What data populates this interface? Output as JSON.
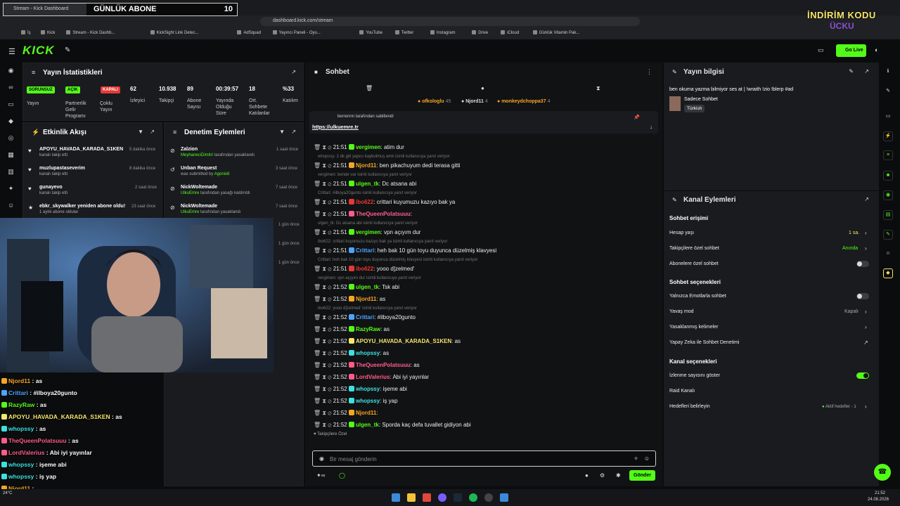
{
  "browser": {
    "tab_title": "Stream - Kick Dashboard",
    "url": "dashboard.kick.com/stream",
    "bookmarks": [
      "İş",
      "Kick",
      "Stream - Kick Dashb...",
      "KickSight Link Detec...",
      "AdSquad",
      "Yayıncı Paneli - Oyu...",
      "YouTube",
      "Twitter",
      "Instagram",
      "Drive",
      "iCloud",
      "Günlük Vitamin Pak..."
    ]
  },
  "overlay_banner": {
    "title": "GÜNLÜK ABONE",
    "count": "10"
  },
  "promo": {
    "line1": "İNDİRİM KODU",
    "line2": "ÜCKU"
  },
  "app": {
    "logo": "KICK",
    "go_live": "Go Live"
  },
  "stats": {
    "title": "Yayın İstatistikleri",
    "items": [
      {
        "badge": "SORUNSUZ",
        "label": "Yayın",
        "color": "#53fc18"
      },
      {
        "badge": "AÇIK",
        "label": "Partnerlik Gelir Programı",
        "color": "#53fc18"
      },
      {
        "badge": "KAPALI",
        "label": "Çoklu Yayın",
        "color": "#e53935"
      },
      {
        "value": "62",
        "label": "İzleyici"
      },
      {
        "value": "10.938",
        "label": "Takipçi"
      },
      {
        "value": "89",
        "label": "Abone Sayısı"
      },
      {
        "value": "00:39:57",
        "label": "Yayında Olduğu Süre"
      },
      {
        "value": "18",
        "label": "Ort. Sohbete Katılanlar"
      },
      {
        "value": "%33",
        "label": "Katılım"
      }
    ]
  },
  "activity": {
    "title": "Etkinlik Akışı",
    "items": [
      {
        "name": "APOYU_HAVADA_KARADA_S1KEN",
        "sub": "kanalı takip etti",
        "time": "5 dakika önce"
      },
      {
        "name": "muzlupastaseverim",
        "sub": "kanalı takip etti",
        "time": "8 dakika önce"
      },
      {
        "name": "gunayevo",
        "sub": "kanalı takip etti",
        "time": "2 saat önce"
      },
      {
        "name": "ebkr_skywalker yeniden abone oldu!",
        "sub": "1 aylık abone oldular",
        "time": "23 saat önce"
      }
    ]
  },
  "moderation": {
    "title": "Denetim Eylemleri",
    "items": [
      {
        "name": "Zalzion",
        "by": "MeyhaneciDimitri",
        "sub": "tarafından yasaklandı",
        "time": "1 saat önce"
      },
      {
        "name": "Unban Request",
        "by": "Agonix8",
        "sub": "was submitted by",
        "time": "3 saat önce"
      },
      {
        "name": "NickWoltemade",
        "by": "UlkuEmre",
        "sub": "tarafından yasağı kaldırıldı",
        "time": "7 saat önce"
      },
      {
        "name": "NickWoltemade",
        "by": "UlkuEmre",
        "sub": "tarafından yasaklandı",
        "time": "7 saat önce"
      }
    ],
    "extra_times": [
      "1 gün önce",
      "1 gün önce",
      "1 gün önce"
    ]
  },
  "chat": {
    "title": "Sohbet",
    "top_gifters": [
      {
        "name": "ofkologlu",
        "n": "45"
      },
      {
        "name": "Njord11",
        "n": "4"
      },
      {
        "name": "monkeydchoppa37",
        "n": "4"
      }
    ],
    "pinned_by": "berrennn tarafından sabitlendi",
    "pinned_link": "https://ulkuemre.tr",
    "messages": [
      {
        "reply": "",
        "time": "21:51",
        "user": "vergimen",
        "color": "#53fc18",
        "text": "atim dur"
      },
      {
        "reply": "whopssy: 2 dk giti yapıcı kaybolmuş amk isimli kullanıcıya yanıt veriyor",
        "time": "21:51",
        "user": "Njord11",
        "color": "#f5a623",
        "text": "ben pikachuyum dedi terasa gitti"
      },
      {
        "reply": "vergimen: bende var isimli kullanıcıya yanıt veriyor",
        "time": "21:51",
        "user": "ulgen_tk",
        "color": "#53fc18",
        "text": "Dc atsana abi"
      },
      {
        "reply": "Crittari: #ilboya20gunto isimli kullanıcıya yanıt veriyor",
        "time": "21:51",
        "user": "ibo622",
        "color": "#e53935",
        "text": "crittari kuyumuzu kazıyo bak ya"
      },
      {
        "reply": "",
        "time": "21:51",
        "user": "TheQueenPolatsuuu",
        "color": "#ff5c8a",
        "text": ""
      },
      {
        "reply": "ulgen_tk: Dc atsana abi isimli kullanıcıya yanıt veriyor",
        "time": "21:51",
        "user": "vergimen",
        "color": "#53fc18",
        "text": "vpn açıyım dur"
      },
      {
        "reply": "ibo622: crittari kuyumuzu kazıyo bak ya isimli kullanıcıya yanıt veriyor",
        "time": "21:51",
        "user": "Crittari",
        "color": "#4fa3ff",
        "text": "heh bak 10 gün toyu duyunca düzelmiş klavyesi"
      },
      {
        "reply": "Crittari: heh bak 10 gün toyu duyunca düzelmiş klavyesi isimli kullanıcıya yanıt veriyor",
        "time": "21:51",
        "user": "ibo622",
        "color": "#e53935",
        "text": "yooo d]zelmed'"
      },
      {
        "reply": "vergimen: vpn açıyım dur isimli kullanıcıya yanıt veriyor",
        "time": "21:52",
        "user": "ulgen_tk",
        "color": "#53fc18",
        "text": "Tsk abi"
      },
      {
        "reply": "",
        "time": "21:52",
        "user": "Njord11",
        "color": "#f5a623",
        "text": "as"
      },
      {
        "reply": "ibo622: yooo d]zelmed' isimli kullanıcıya yanıt veriyor",
        "time": "21:52",
        "user": "Crittari",
        "color": "#4fa3ff",
        "text": "#ilboya20gunto"
      },
      {
        "reply": "",
        "time": "21:52",
        "user": "RazyRaw",
        "color": "#53fc18",
        "text": "as"
      },
      {
        "reply": "",
        "time": "21:52",
        "user": "APOYU_HAVADA_KARADA_S1KEN",
        "color": "#f5e66b",
        "text": "as"
      },
      {
        "reply": "",
        "time": "21:52",
        "user": "whopssy",
        "color": "#3ee0e0",
        "text": "as"
      },
      {
        "reply": "",
        "time": "21:52",
        "user": "TheQueenPolatsuuu",
        "color": "#ff5c8a",
        "text": "as"
      },
      {
        "reply": "",
        "time": "21:52",
        "user": "LordValerius",
        "color": "#ff5c8a",
        "text": "Abi iyi yayınlar"
      },
      {
        "reply": "",
        "time": "21:52",
        "user": "whopssy",
        "color": "#3ee0e0",
        "text": "işeme abi"
      },
      {
        "reply": "",
        "time": "21:52",
        "user": "whopssy",
        "color": "#3ee0e0",
        "text": "iş yap"
      },
      {
        "reply": "",
        "time": "21:52",
        "user": "Njord11",
        "color": "#f5a623",
        "text": ""
      },
      {
        "reply": "",
        "time": "21:52",
        "user": "ulgen_tk",
        "color": "#53fc18",
        "text": "Sporda kaç defa tuvallet gidiyon abi"
      }
    ],
    "followers_only": "Takipçilere Özel",
    "input_placeholder": "Bir mesaj gönderin",
    "send": "Gönder"
  },
  "stream_info": {
    "title": "Yayın bilgisi",
    "stream_title": "ben okuma yazma bilmiyor ses at | !wraith !zio !blerp #ad",
    "category": "Sadece Sohbet",
    "tag": "Türkish"
  },
  "channel_actions": {
    "title": "Kanal Eylemleri",
    "sections": [
      {
        "header": "Sohbet erişimi",
        "rows": [
          {
            "label": "Hesap yaşı",
            "value": "1 sa."
          },
          {
            "label": "Takipçilere özel sohbet",
            "value": "Anında"
          },
          {
            "label": "Abonelere özel sohbet",
            "value": ""
          }
        ]
      },
      {
        "header": "Sohbet seçenekleri",
        "rows": [
          {
            "label": "Yalnızca Emotlarla sohbet",
            "value": ""
          },
          {
            "label": "Yavaş mod",
            "value": "Kapalı"
          },
          {
            "label": "Yasaklanmış kelimeler",
            "value": ""
          },
          {
            "label": "Yapay Zeka ile Sohbet Denetimi",
            "value": ""
          }
        ]
      },
      {
        "header": "Kanal seçenekleri",
        "rows": [
          {
            "label": "İzlenme sayısını göster",
            "value": ""
          },
          {
            "label": "Raid Kanalı",
            "value": ""
          },
          {
            "label": "Hedefleri belirleyin",
            "value": "Aktif hedefler - 1"
          }
        ]
      }
    ]
  },
  "overlay_chat": [
    {
      "user": "Njord11",
      "color": "#f5a623",
      "text": "as"
    },
    {
      "user": "Crittari",
      "color": "#4fa3ff",
      "text": "#ilboya20gunto"
    },
    {
      "user": "RazyRaw",
      "color": "#53fc18",
      "text": "as"
    },
    {
      "user": "APOYU_HAVADA_KARADA_S1KEN",
      "color": "#f5e66b",
      "text": "as"
    },
    {
      "user": "whopssy",
      "color": "#3ee0e0",
      "text": "as"
    },
    {
      "user": "TheQueenPolatsuuu",
      "color": "#ff5c8a",
      "text": "as"
    },
    {
      "user": "LordValerius",
      "color": "#ff5c8a",
      "text": "Abi iyi yayınlar"
    },
    {
      "user": "whopssy",
      "color": "#3ee0e0",
      "text": "işeme abi"
    },
    {
      "user": "whopssy",
      "color": "#3ee0e0",
      "text": "iş yap"
    },
    {
      "user": "Njord11",
      "color": "#f5a623",
      "text": ""
    },
    {
      "user": "ulgen_tk",
      "color": "#53fc18",
      "text": "Sporda kaç defa tuvallet gidiyon abi"
    }
  ],
  "taskbar": {
    "weather": "24°C",
    "time": "21:52",
    "date": "24.08.2026"
  }
}
